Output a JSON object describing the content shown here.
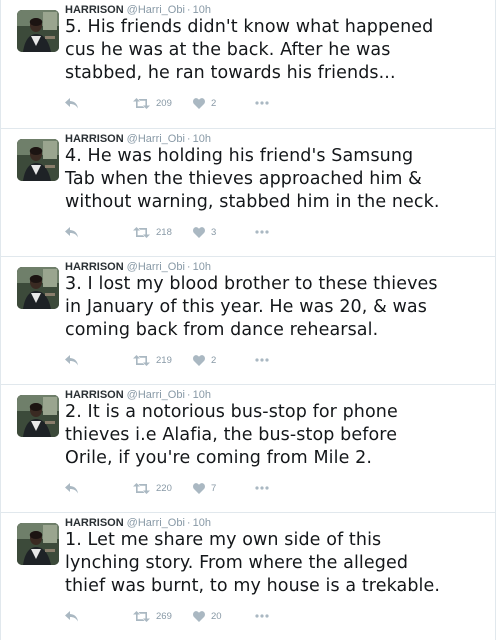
{
  "tweets": [
    {
      "name": "HARRISON",
      "handle": "@Harri_Obi",
      "separator": "·",
      "time": "10h",
      "text": "5. His friends didn't know what happened\ncus he was at the back. After he was\nstabbed, he ran towards his friends...",
      "retweets": "209",
      "likes": "2"
    },
    {
      "name": "HARRISON",
      "handle": "@Harri_Obi",
      "separator": "·",
      "time": "10h",
      "text": "4. He was holding his friend's Samsung\nTab when the thieves approached him &\nwithout warning, stabbed him in the neck.",
      "retweets": "218",
      "likes": "3"
    },
    {
      "name": "HARRISON",
      "handle": "@Harri_Obi",
      "separator": "·",
      "time": "10h",
      "text": "3. I lost my blood brother to these thieves\nin January of this year. He was 20, & was\ncoming back from dance rehearsal.",
      "retweets": "219",
      "likes": "2"
    },
    {
      "name": "HARRISON",
      "handle": "@Harri_Obi",
      "separator": "·",
      "time": "10h",
      "text": "2. It is a notorious bus-stop for phone\nthieves i.e Alafia, the bus-stop before\nOrile, if you're coming from Mile 2.",
      "retweets": "220",
      "likes": "7"
    },
    {
      "name": "HARRISON",
      "handle": "@Harri_Obi",
      "separator": "·",
      "time": "10h",
      "text": "1. Let me share my own side of this\nlynching story. From where the alleged\nthief was burnt, to my house is a trekable.",
      "retweets": "269",
      "likes": "20"
    }
  ],
  "colors": {
    "border": "#e1e8ed",
    "text": "#14171a",
    "muted": "#8899a6",
    "icon": "#aab8c2"
  },
  "icons": {
    "reply": "reply-icon",
    "retweet": "retweet-icon",
    "like": "heart-icon",
    "more": "more-dots-icon"
  }
}
